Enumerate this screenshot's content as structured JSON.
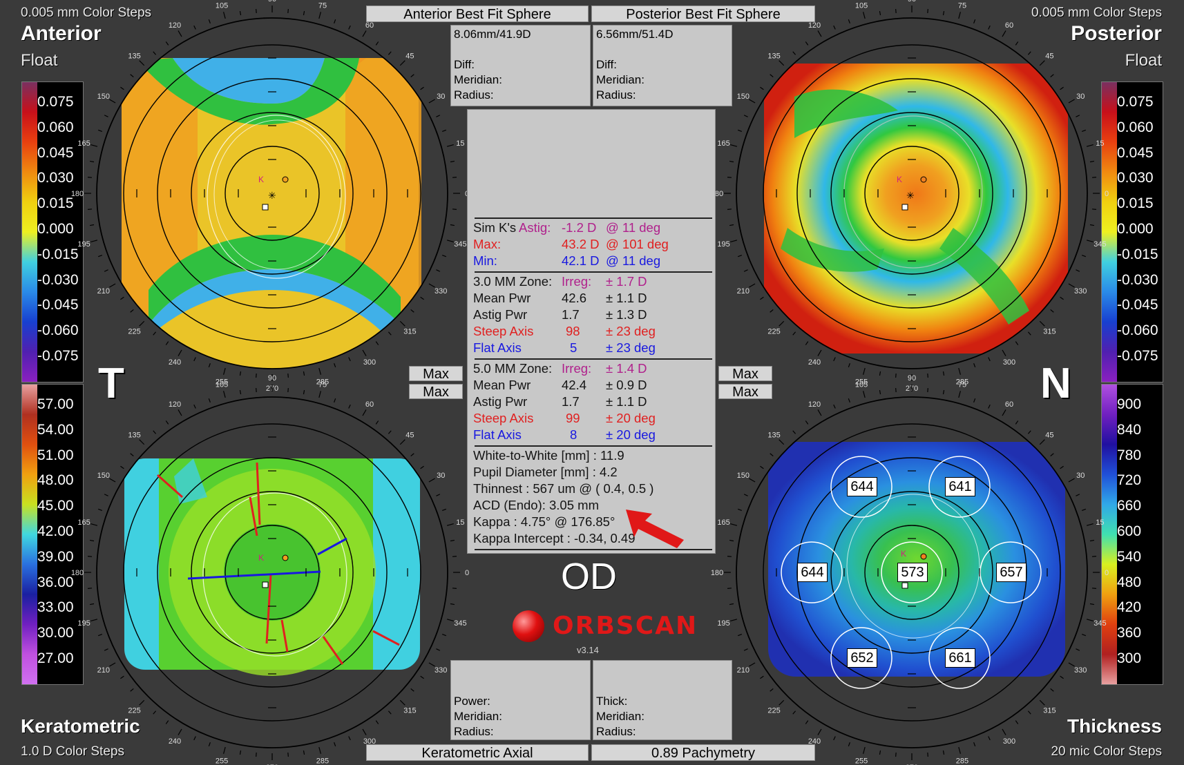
{
  "colors": {
    "bg": "#3a3a3a",
    "panel": "#c8c8c8",
    "accent_red": "#e02020",
    "accent_blue": "#1818e0"
  },
  "header": {
    "anterior_steps": "0.005 mm Color Steps",
    "anterior_title": "Anterior",
    "anterior_sub": "Float",
    "posterior_steps": "0.005 mm Color Steps",
    "posterior_title": "Posterior",
    "posterior_sub": "Float",
    "tab_anterior": "Anterior Best Fit Sphere",
    "tab_posterior": "Posterior Best Fit Sphere"
  },
  "anterior_info": {
    "value": "8.06mm/41.9D",
    "diff": "Diff:",
    "meridian": "Meridian:",
    "radius": "Radius:"
  },
  "posterior_info": {
    "value": "6.56mm/51.4D",
    "diff": "Diff:",
    "meridian": "Meridian:",
    "radius": "Radius:"
  },
  "simk": {
    "label": "Sim K's",
    "astig_label": "Astig:",
    "astig_value": "-1.2 D",
    "astig_axis": "@ 11 deg",
    "max_label": "Max:",
    "max_value": "43.2 D",
    "max_axis": "@ 101 deg",
    "min_label": "Min:",
    "min_value": "42.1 D",
    "min_axis": "@ 11 deg"
  },
  "zone3": {
    "title": "3.0 MM Zone:",
    "irreg_label": "Irreg:",
    "irreg_value": "± 1.7 D",
    "mean_label": "Mean Pwr",
    "mean_value": "42.6",
    "mean_pm": "± 1.1 D",
    "astig_label": "Astig Pwr",
    "astig_value": "1.7",
    "astig_pm": "± 1.3 D",
    "steep_label": "Steep Axis",
    "steep_value": "98",
    "steep_pm": "± 23 deg",
    "flat_label": "Flat Axis",
    "flat_value": "5",
    "flat_pm": "± 23 deg"
  },
  "zone5": {
    "title": "5.0 MM Zone:",
    "irreg_label": "Irreg:",
    "irreg_value": "± 1.4 D",
    "mean_label": "Mean Pwr",
    "mean_value": "42.4",
    "mean_pm": "± 0.9 D",
    "astig_label": "Astig Pwr",
    "astig_value": "1.7",
    "astig_pm": "± 1.1 D",
    "steep_label": "Steep Axis",
    "steep_value": "99",
    "steep_pm": "± 20 deg",
    "flat_label": "Flat Axis",
    "flat_value": "8",
    "flat_pm": "± 20 deg"
  },
  "measures": {
    "wtw": "White-to-White [mm] : 11.9",
    "pupil": "Pupil Diameter [mm] :  4.2",
    "thinnest": "Thinnest : 567 um @ ( 0.4, 0.5 )",
    "acd": "ACD (Endo): 3.05 mm",
    "kappa": "Kappa : 4.75° @ 176.85°",
    "kappa_intercept": "Kappa Intercept : -0.34, 0.49"
  },
  "max_buttons": [
    "Max",
    "Max",
    "Max",
    "Max"
  ],
  "side": {
    "t": "T",
    "n": "N",
    "eye": "OD"
  },
  "logo": {
    "brand": "ORBSCAN",
    "version": "v3.14"
  },
  "bottom_left_info": {
    "power": "Power:",
    "meridian": "Meridian:",
    "radius": "Radius:"
  },
  "bottom_right_info": {
    "thick": "Thick:",
    "meridian": "Meridian:",
    "radius": "Radius:"
  },
  "footer": {
    "kera_title": "Keratometric",
    "kera_steps": "1.0 D Color Steps",
    "thick_title": "Thickness",
    "thick_steps": "20 mic Color Steps",
    "tab_kera": "Keratometric Axial",
    "tab_pachy": "0.89 Pachymetry"
  },
  "float_scale": [
    "0.075",
    "0.060",
    "0.045",
    "0.030",
    "0.015",
    "0.000",
    "-0.015",
    "-0.030",
    "-0.045",
    "-0.060",
    "-0.075"
  ],
  "kera_scale": [
    "57.00",
    "54.00",
    "51.00",
    "48.00",
    "45.00",
    "42.00",
    "39.00",
    "36.00",
    "33.00",
    "30.00",
    "27.00"
  ],
  "thick_scale": [
    "900",
    "840",
    "780",
    "720",
    "660",
    "600",
    "540",
    "480",
    "420",
    "360",
    "300"
  ],
  "degree_labels": [
    "0",
    "15",
    "30",
    "45",
    "60",
    "75",
    "90",
    "105",
    "120",
    "135",
    "150",
    "165",
    "180",
    "195",
    "210",
    "225",
    "240",
    "255",
    "270",
    "285",
    "300",
    "315",
    "330",
    "345"
  ],
  "pachy_values": {
    "center": "573",
    "upper_left": "644",
    "upper_right": "641",
    "left": "644",
    "right": "657",
    "lower_left": "652",
    "lower_right": "661"
  },
  "map_marks": {
    "k": "K"
  }
}
